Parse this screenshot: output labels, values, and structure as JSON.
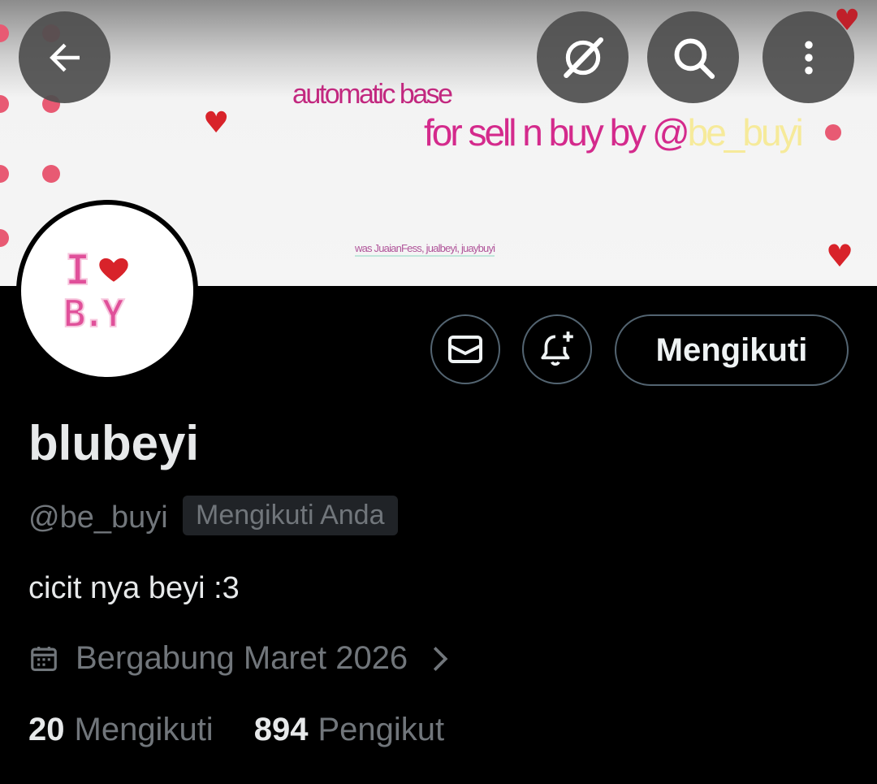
{
  "banner": {
    "line1": "automatic base",
    "line2_prefix": "for sell n buy by @",
    "line2_handle": "be_buyi",
    "line3": "was JuaianFess, jualbeyi, juaybuyi"
  },
  "avatar": {
    "logo_text_top": "I",
    "logo_text_bottom": "B.Y"
  },
  "top_bar": {
    "back_icon": "arrow-left-icon",
    "grok_icon": "grok-icon",
    "search_icon": "search-icon",
    "more_icon": "more-vertical-icon"
  },
  "actions": {
    "message_icon": "envelope-icon",
    "notify_icon": "bell-plus-icon",
    "follow_label": "Mengikuti"
  },
  "profile": {
    "display_name": "blubeyi",
    "handle": "@be_buyi",
    "follows_you_badge": "Mengikuti Anda",
    "bio": "cicit nya beyi :3",
    "joined": "Bergabung Maret 2026",
    "following_count": "20",
    "following_label": "Mengikuti",
    "followers_count": "894",
    "followers_label": "Pengikut"
  },
  "colors": {
    "background": "#000000",
    "text_primary": "#e7e9ea",
    "text_secondary": "#71767b",
    "border": "#536471",
    "banner_pink": "#d42a8c",
    "banner_yellow": "#f6ea9a",
    "heart_red": "#d8232a"
  }
}
